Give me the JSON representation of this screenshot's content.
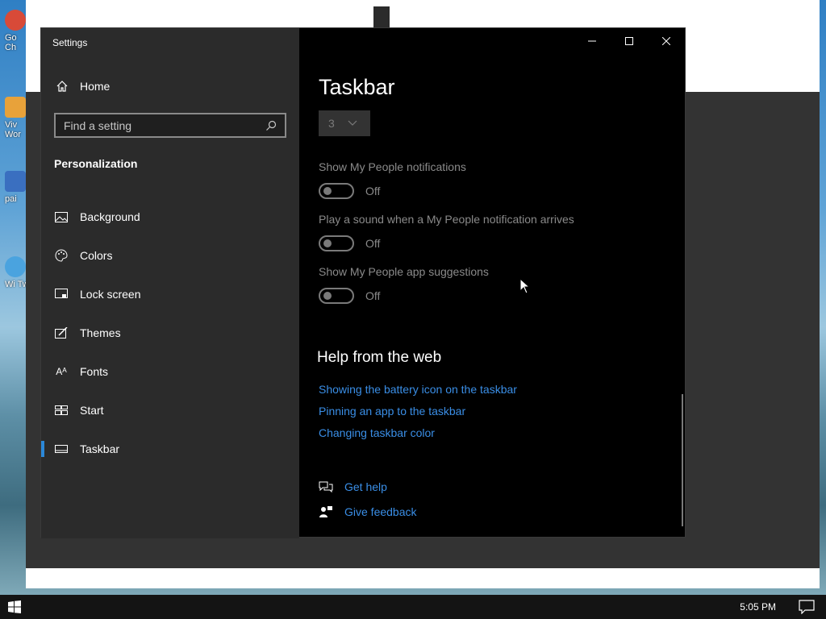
{
  "desktop": {
    "icons": [
      {
        "label": "Go Ch",
        "icon": "chrome-icon",
        "color": "#d84a38"
      },
      {
        "label": "Viv Wor",
        "icon": "vivaldi-icon",
        "color": "#e8a23a"
      },
      {
        "label": "pai",
        "icon": "paint-icon",
        "color": "#3a6fc0"
      },
      {
        "label": "Wi Tw",
        "icon": "windows-tweaker-icon",
        "color": "#4aa3df"
      }
    ]
  },
  "window": {
    "title": "Settings",
    "controls": {
      "minimize": "—",
      "maximize": "☐",
      "close": "✕"
    }
  },
  "sidebar": {
    "home_label": "Home",
    "search_placeholder": "Find a setting",
    "section_title": "Personalization",
    "items": [
      {
        "label": "Background",
        "icon": "picture-icon"
      },
      {
        "label": "Colors",
        "icon": "palette-icon"
      },
      {
        "label": "Lock screen",
        "icon": "lock-screen-icon"
      },
      {
        "label": "Themes",
        "icon": "brush-icon"
      },
      {
        "label": "Fonts",
        "icon": "font-icon"
      },
      {
        "label": "Start",
        "icon": "start-tiles-icon"
      },
      {
        "label": "Taskbar",
        "icon": "taskbar-icon",
        "active": true
      }
    ]
  },
  "main": {
    "page_title": "Taskbar",
    "dropdown_value": "3",
    "settings": [
      {
        "label": "Show My People notifications",
        "state": "Off"
      },
      {
        "label": "Play a sound when a My People notification arrives",
        "state": "Off"
      },
      {
        "label": "Show My People app suggestions",
        "state": "Off"
      }
    ],
    "help_title": "Help from the web",
    "links": [
      "Showing the battery icon on the taskbar",
      "Pinning an app to the taskbar",
      "Changing taskbar color"
    ],
    "get_help": "Get help",
    "give_feedback": "Give feedback"
  },
  "taskbar": {
    "clock": "5:05 PM"
  },
  "colors": {
    "accent": "#2b88d8",
    "link": "#3a8ee6",
    "sidebar_bg": "#2b2b2b",
    "content_bg": "#000000"
  }
}
